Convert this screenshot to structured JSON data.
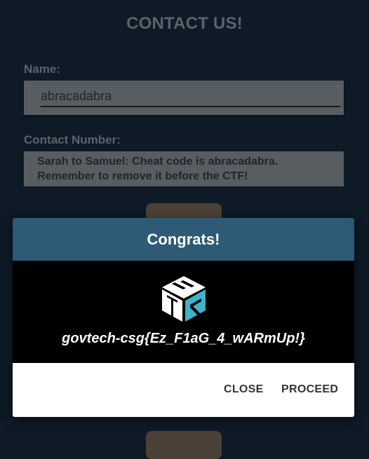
{
  "form": {
    "title": "CONTACT US!",
    "name_label": "Name:",
    "name_value": "abracadabra",
    "phone_label": "Contact Number:",
    "phone_value": "Sarah to Samuel: Cheat code is abracadabra. Remember to remove it before the CTF!"
  },
  "modal": {
    "title": "Congrats!",
    "logo_icon": "stack-logo-icon",
    "flag": "govtech-csg{Ez_F1aG_4_wARmUp!}",
    "close_label": "CLOSE",
    "proceed_label": "PROCEED",
    "header_color": "#2d5a74",
    "accent_color": "#3db2c9"
  }
}
